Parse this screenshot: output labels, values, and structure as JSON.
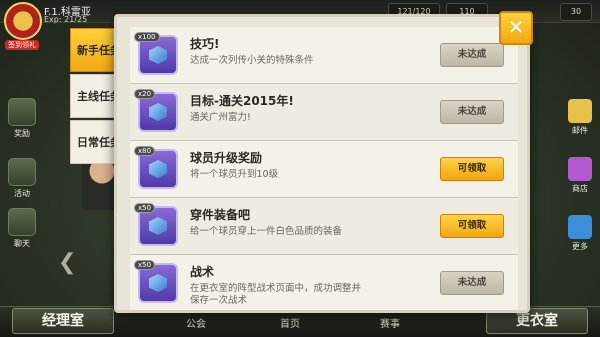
{
  "header": {
    "player_name": "F.1.科雷亚",
    "exp": "Exp: 21/25",
    "stat_1": "121/120",
    "stat_2": "110",
    "stat_3": "30"
  },
  "left_rail": {
    "badge_label": "签到领礼",
    "items": [
      {
        "label": "奖励"
      },
      {
        "label": "活动"
      },
      {
        "label": "聊天"
      }
    ]
  },
  "right_rail": {
    "items": [
      {
        "label": "邮件"
      },
      {
        "label": "商店"
      },
      {
        "label": "更多"
      }
    ]
  },
  "bottom_bar": {
    "manager_label": "经理室",
    "locker_label": "更衣室",
    "mid_labels": [
      "公会",
      "首页",
      "赛事"
    ]
  },
  "modal": {
    "close_label": "✕",
    "tabs": [
      {
        "label": "新手任务",
        "active": true,
        "dot": true
      },
      {
        "label": "主线任务",
        "active": false,
        "dot": true
      },
      {
        "label": "日常任务",
        "active": false,
        "dot": false
      }
    ],
    "tasks": [
      {
        "qty": "x100",
        "title": "技巧!",
        "desc": "达成一次列传小关的特殊条件",
        "status": "未达成",
        "status_type": "incomplete"
      },
      {
        "qty": "x20",
        "title": "目标-通关2015年!",
        "desc": "通关广州富力!",
        "status": "未达成",
        "status_type": "incomplete"
      },
      {
        "qty": "x80",
        "title": "球员升级奖励",
        "desc": "将一个球员升到10级",
        "status": "可领取",
        "status_type": "claim"
      },
      {
        "qty": "x50",
        "title": "穿件装备吧",
        "desc": "给一个球员穿上一件白色品质的装备",
        "status": "可领取",
        "status_type": "claim"
      },
      {
        "qty": "x50",
        "title": "战术",
        "desc": "在更衣室的阵型战术页面中，成功调整并保存一次战术",
        "status": "未达成",
        "status_type": "incomplete"
      }
    ]
  }
}
